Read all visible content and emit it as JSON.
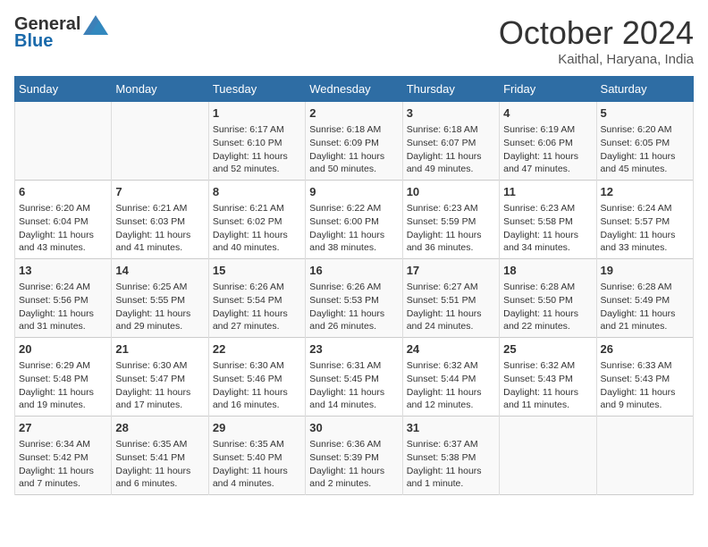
{
  "logo": {
    "general": "General",
    "blue": "Blue"
  },
  "title": {
    "month": "October 2024",
    "location": "Kaithal, Haryana, India"
  },
  "weekdays": [
    "Sunday",
    "Monday",
    "Tuesday",
    "Wednesday",
    "Thursday",
    "Friday",
    "Saturday"
  ],
  "weeks": [
    [
      {
        "day": "",
        "sunrise": "",
        "sunset": "",
        "daylight": ""
      },
      {
        "day": "",
        "sunrise": "",
        "sunset": "",
        "daylight": ""
      },
      {
        "day": "1",
        "sunrise": "Sunrise: 6:17 AM",
        "sunset": "Sunset: 6:10 PM",
        "daylight": "Daylight: 11 hours and 52 minutes."
      },
      {
        "day": "2",
        "sunrise": "Sunrise: 6:18 AM",
        "sunset": "Sunset: 6:09 PM",
        "daylight": "Daylight: 11 hours and 50 minutes."
      },
      {
        "day": "3",
        "sunrise": "Sunrise: 6:18 AM",
        "sunset": "Sunset: 6:07 PM",
        "daylight": "Daylight: 11 hours and 49 minutes."
      },
      {
        "day": "4",
        "sunrise": "Sunrise: 6:19 AM",
        "sunset": "Sunset: 6:06 PM",
        "daylight": "Daylight: 11 hours and 47 minutes."
      },
      {
        "day": "5",
        "sunrise": "Sunrise: 6:20 AM",
        "sunset": "Sunset: 6:05 PM",
        "daylight": "Daylight: 11 hours and 45 minutes."
      }
    ],
    [
      {
        "day": "6",
        "sunrise": "Sunrise: 6:20 AM",
        "sunset": "Sunset: 6:04 PM",
        "daylight": "Daylight: 11 hours and 43 minutes."
      },
      {
        "day": "7",
        "sunrise": "Sunrise: 6:21 AM",
        "sunset": "Sunset: 6:03 PM",
        "daylight": "Daylight: 11 hours and 41 minutes."
      },
      {
        "day": "8",
        "sunrise": "Sunrise: 6:21 AM",
        "sunset": "Sunset: 6:02 PM",
        "daylight": "Daylight: 11 hours and 40 minutes."
      },
      {
        "day": "9",
        "sunrise": "Sunrise: 6:22 AM",
        "sunset": "Sunset: 6:00 PM",
        "daylight": "Daylight: 11 hours and 38 minutes."
      },
      {
        "day": "10",
        "sunrise": "Sunrise: 6:23 AM",
        "sunset": "Sunset: 5:59 PM",
        "daylight": "Daylight: 11 hours and 36 minutes."
      },
      {
        "day": "11",
        "sunrise": "Sunrise: 6:23 AM",
        "sunset": "Sunset: 5:58 PM",
        "daylight": "Daylight: 11 hours and 34 minutes."
      },
      {
        "day": "12",
        "sunrise": "Sunrise: 6:24 AM",
        "sunset": "Sunset: 5:57 PM",
        "daylight": "Daylight: 11 hours and 33 minutes."
      }
    ],
    [
      {
        "day": "13",
        "sunrise": "Sunrise: 6:24 AM",
        "sunset": "Sunset: 5:56 PM",
        "daylight": "Daylight: 11 hours and 31 minutes."
      },
      {
        "day": "14",
        "sunrise": "Sunrise: 6:25 AM",
        "sunset": "Sunset: 5:55 PM",
        "daylight": "Daylight: 11 hours and 29 minutes."
      },
      {
        "day": "15",
        "sunrise": "Sunrise: 6:26 AM",
        "sunset": "Sunset: 5:54 PM",
        "daylight": "Daylight: 11 hours and 27 minutes."
      },
      {
        "day": "16",
        "sunrise": "Sunrise: 6:26 AM",
        "sunset": "Sunset: 5:53 PM",
        "daylight": "Daylight: 11 hours and 26 minutes."
      },
      {
        "day": "17",
        "sunrise": "Sunrise: 6:27 AM",
        "sunset": "Sunset: 5:51 PM",
        "daylight": "Daylight: 11 hours and 24 minutes."
      },
      {
        "day": "18",
        "sunrise": "Sunrise: 6:28 AM",
        "sunset": "Sunset: 5:50 PM",
        "daylight": "Daylight: 11 hours and 22 minutes."
      },
      {
        "day": "19",
        "sunrise": "Sunrise: 6:28 AM",
        "sunset": "Sunset: 5:49 PM",
        "daylight": "Daylight: 11 hours and 21 minutes."
      }
    ],
    [
      {
        "day": "20",
        "sunrise": "Sunrise: 6:29 AM",
        "sunset": "Sunset: 5:48 PM",
        "daylight": "Daylight: 11 hours and 19 minutes."
      },
      {
        "day": "21",
        "sunrise": "Sunrise: 6:30 AM",
        "sunset": "Sunset: 5:47 PM",
        "daylight": "Daylight: 11 hours and 17 minutes."
      },
      {
        "day": "22",
        "sunrise": "Sunrise: 6:30 AM",
        "sunset": "Sunset: 5:46 PM",
        "daylight": "Daylight: 11 hours and 16 minutes."
      },
      {
        "day": "23",
        "sunrise": "Sunrise: 6:31 AM",
        "sunset": "Sunset: 5:45 PM",
        "daylight": "Daylight: 11 hours and 14 minutes."
      },
      {
        "day": "24",
        "sunrise": "Sunrise: 6:32 AM",
        "sunset": "Sunset: 5:44 PM",
        "daylight": "Daylight: 11 hours and 12 minutes."
      },
      {
        "day": "25",
        "sunrise": "Sunrise: 6:32 AM",
        "sunset": "Sunset: 5:43 PM",
        "daylight": "Daylight: 11 hours and 11 minutes."
      },
      {
        "day": "26",
        "sunrise": "Sunrise: 6:33 AM",
        "sunset": "Sunset: 5:43 PM",
        "daylight": "Daylight: 11 hours and 9 minutes."
      }
    ],
    [
      {
        "day": "27",
        "sunrise": "Sunrise: 6:34 AM",
        "sunset": "Sunset: 5:42 PM",
        "daylight": "Daylight: 11 hours and 7 minutes."
      },
      {
        "day": "28",
        "sunrise": "Sunrise: 6:35 AM",
        "sunset": "Sunset: 5:41 PM",
        "daylight": "Daylight: 11 hours and 6 minutes."
      },
      {
        "day": "29",
        "sunrise": "Sunrise: 6:35 AM",
        "sunset": "Sunset: 5:40 PM",
        "daylight": "Daylight: 11 hours and 4 minutes."
      },
      {
        "day": "30",
        "sunrise": "Sunrise: 6:36 AM",
        "sunset": "Sunset: 5:39 PM",
        "daylight": "Daylight: 11 hours and 2 minutes."
      },
      {
        "day": "31",
        "sunrise": "Sunrise: 6:37 AM",
        "sunset": "Sunset: 5:38 PM",
        "daylight": "Daylight: 11 hours and 1 minute."
      },
      {
        "day": "",
        "sunrise": "",
        "sunset": "",
        "daylight": ""
      },
      {
        "day": "",
        "sunrise": "",
        "sunset": "",
        "daylight": ""
      }
    ]
  ]
}
